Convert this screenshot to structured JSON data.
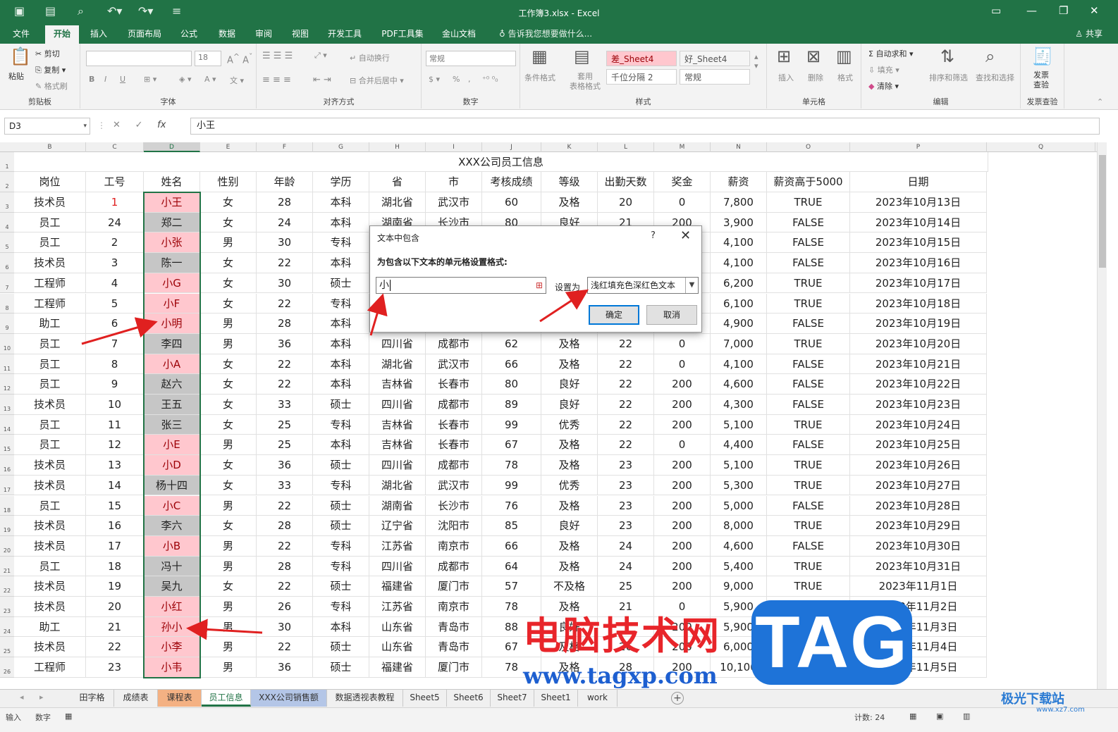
{
  "window": {
    "title": "工作簿3.xlsx - Excel",
    "quick_access": [
      "save-icon",
      "touch-icon",
      "preview-icon",
      "undo-icon",
      "redo-icon",
      "customize-icon"
    ]
  },
  "ribbon_tabs": [
    "文件",
    "开始",
    "插入",
    "页面布局",
    "公式",
    "数据",
    "审阅",
    "视图",
    "开发工具",
    "PDF工具集",
    "金山文档"
  ],
  "active_tab": "开始",
  "tell_me": "告诉我您想要做什么...",
  "share_label": "共享",
  "ribbon": {
    "clipboard": {
      "paste": "粘贴",
      "cut": "剪切",
      "copy": "复制",
      "format_painter": "格式刷",
      "label": "剪贴板"
    },
    "font": {
      "font_size": "18",
      "label": "字体",
      "bold": "B",
      "italic": "I",
      "underline": "U"
    },
    "alignment": {
      "wrap": "自动换行",
      "merge": "合并后居中",
      "label": "对齐方式"
    },
    "number": {
      "format": "常规",
      "percent": "%",
      "label": "数字"
    },
    "styles": {
      "conditional": "条件格式",
      "table": "套用\n表格格式",
      "cells": [
        "差_Sheet4",
        "好_Sheet4",
        "千位分隔 2",
        "常规"
      ],
      "label": "样式"
    },
    "cells": {
      "insert": "插入",
      "delete": "删除",
      "format": "格式",
      "label": "单元格"
    },
    "editing": {
      "autosum": "自动求和",
      "fill": "填充",
      "clear": "清除",
      "sort": "排序和筛选",
      "find": "查找和选择",
      "label": "编辑"
    },
    "invoice": {
      "check": "发票\n查验",
      "label": "发票查验"
    }
  },
  "formula_bar": {
    "name_box": "D3",
    "fx": "fx",
    "value": "小王"
  },
  "columns": [
    "B",
    "C",
    "D",
    "E",
    "F",
    "G",
    "H",
    "I",
    "J",
    "K",
    "L",
    "M",
    "N",
    "O",
    "P",
    "Q"
  ],
  "selected_column": "D",
  "sheet_title": "XXX公司员工信息",
  "headers": [
    "岗位",
    "工号",
    "姓名",
    "性别",
    "年龄",
    "学历",
    "省",
    "市",
    "考核成绩",
    "等级",
    "出勤天数",
    "奖金",
    "薪资",
    "薪资高于5000",
    "日期"
  ],
  "rows": [
    [
      "技术员",
      "1",
      "小王",
      "女",
      "28",
      "本科",
      "湖北省",
      "武汉市",
      "60",
      "及格",
      "20",
      "0",
      "7,800",
      "TRUE",
      "2023年10月13日"
    ],
    [
      "员工",
      "24",
      "郑二",
      "女",
      "24",
      "本科",
      "湖南省",
      "长沙市",
      "80",
      "良好",
      "21",
      "200",
      "3,900",
      "FALSE",
      "2023年10月14日"
    ],
    [
      "员工",
      "2",
      "小张",
      "男",
      "30",
      "专科",
      "",
      "",
      "",
      "",
      "",
      "",
      "4,100",
      "FALSE",
      "2023年10月15日"
    ],
    [
      "技术员",
      "3",
      "陈一",
      "女",
      "22",
      "本科",
      "",
      "",
      "",
      "",
      "",
      "",
      "4,100",
      "FALSE",
      "2023年10月16日"
    ],
    [
      "工程师",
      "4",
      "小G",
      "女",
      "30",
      "硕士",
      "",
      "",
      "",
      "",
      "",
      "",
      "6,200",
      "TRUE",
      "2023年10月17日"
    ],
    [
      "工程师",
      "5",
      "小F",
      "女",
      "22",
      "专科",
      "",
      "",
      "",
      "",
      "",
      "",
      "6,100",
      "TRUE",
      "2023年10月18日"
    ],
    [
      "助工",
      "6",
      "小明",
      "男",
      "28",
      "本科",
      "",
      "",
      "",
      "",
      "",
      "",
      "4,900",
      "FALSE",
      "2023年10月19日"
    ],
    [
      "员工",
      "7",
      "李四",
      "男",
      "36",
      "本科",
      "四川省",
      "成都市",
      "62",
      "及格",
      "22",
      "0",
      "7,000",
      "TRUE",
      "2023年10月20日"
    ],
    [
      "员工",
      "8",
      "小A",
      "女",
      "22",
      "本科",
      "湖北省",
      "武汉市",
      "66",
      "及格",
      "22",
      "0",
      "4,100",
      "FALSE",
      "2023年10月21日"
    ],
    [
      "员工",
      "9",
      "赵六",
      "女",
      "22",
      "本科",
      "吉林省",
      "长春市",
      "80",
      "良好",
      "22",
      "200",
      "4,600",
      "FALSE",
      "2023年10月22日"
    ],
    [
      "技术员",
      "10",
      "王五",
      "女",
      "33",
      "硕士",
      "四川省",
      "成都市",
      "89",
      "良好",
      "22",
      "200",
      "4,300",
      "FALSE",
      "2023年10月23日"
    ],
    [
      "员工",
      "11",
      "张三",
      "女",
      "25",
      "专科",
      "吉林省",
      "长春市",
      "99",
      "优秀",
      "22",
      "200",
      "5,100",
      "TRUE",
      "2023年10月24日"
    ],
    [
      "员工",
      "12",
      "小E",
      "男",
      "25",
      "本科",
      "吉林省",
      "长春市",
      "67",
      "及格",
      "22",
      "0",
      "4,400",
      "FALSE",
      "2023年10月25日"
    ],
    [
      "技术员",
      "13",
      "小D",
      "女",
      "36",
      "硕士",
      "四川省",
      "成都市",
      "78",
      "及格",
      "23",
      "200",
      "5,100",
      "TRUE",
      "2023年10月26日"
    ],
    [
      "技术员",
      "14",
      "杨十四",
      "女",
      "33",
      "专科",
      "湖北省",
      "武汉市",
      "99",
      "优秀",
      "23",
      "200",
      "5,300",
      "TRUE",
      "2023年10月27日"
    ],
    [
      "员工",
      "15",
      "小C",
      "男",
      "22",
      "硕士",
      "湖南省",
      "长沙市",
      "76",
      "及格",
      "23",
      "200",
      "5,000",
      "FALSE",
      "2023年10月28日"
    ],
    [
      "技术员",
      "16",
      "李六",
      "女",
      "28",
      "硕士",
      "辽宁省",
      "沈阳市",
      "85",
      "良好",
      "23",
      "200",
      "8,000",
      "TRUE",
      "2023年10月29日"
    ],
    [
      "技术员",
      "17",
      "小B",
      "男",
      "22",
      "专科",
      "江苏省",
      "南京市",
      "66",
      "及格",
      "24",
      "200",
      "4,600",
      "FALSE",
      "2023年10月30日"
    ],
    [
      "员工",
      "18",
      "冯十",
      "男",
      "28",
      "专科",
      "四川省",
      "成都市",
      "64",
      "及格",
      "24",
      "200",
      "5,400",
      "TRUE",
      "2023年10月31日"
    ],
    [
      "技术员",
      "19",
      "吴九",
      "女",
      "22",
      "硕士",
      "福建省",
      "厦门市",
      "57",
      "不及格",
      "25",
      "200",
      "9,000",
      "TRUE",
      "2023年11月1日"
    ],
    [
      "技术员",
      "20",
      "小红",
      "男",
      "26",
      "专科",
      "江苏省",
      "南京市",
      "78",
      "及格",
      "21",
      "0",
      "5,900",
      "TRUE",
      "2023年11月2日"
    ],
    [
      "助工",
      "21",
      "孙小",
      "男",
      "30",
      "本科",
      "山东省",
      "青岛市",
      "88",
      "良好",
      "",
      "200",
      "5,900",
      "FALSE",
      "2023年11月3日"
    ],
    [
      "技术员",
      "22",
      "小李",
      "男",
      "22",
      "硕士",
      "山东省",
      "青岛市",
      "67",
      "及格",
      "26",
      "200",
      "6,000",
      "TRUE",
      "2023年11月4日"
    ],
    [
      "工程师",
      "23",
      "小韦",
      "男",
      "36",
      "硕士",
      "福建省",
      "厦门市",
      "78",
      "及格",
      "28",
      "200",
      "10,100",
      "TRUE",
      "2023年11月5日"
    ]
  ],
  "highlighted_names": [
    "小王",
    "小张",
    "小G",
    "小F",
    "小明",
    "小A",
    "小E",
    "小D",
    "小C",
    "小B",
    "小红",
    "孙小",
    "小李",
    "小韦"
  ],
  "sheet_tabs": [
    "田字格",
    "成绩表",
    "课程表",
    "员工信息",
    "XXX公司销售额",
    "数据透视表教程",
    "Sheet5",
    "Sheet6",
    "Sheet7",
    "Sheet1",
    "work"
  ],
  "active_sheet": "员工信息",
  "status_bar": {
    "mode": "输入",
    "num": "数字",
    "count": "计数: 24"
  },
  "dialog": {
    "title": "文本中包含",
    "help": "?",
    "close": "✕",
    "prompt": "为包含以下文本的单元格设置格式:",
    "input_value": "小",
    "set_as_label": "设置为",
    "format_option": "浅红填充色深红色文本",
    "ok": "确定",
    "cancel": "取消"
  },
  "watermark": {
    "text": "电脑技术网",
    "url": "www.tagxp.com",
    "tag": "TAG",
    "site": "极光下载站",
    "site_url": "www.xz7.com"
  },
  "colors": {
    "excel_green": "#217346",
    "highlight_fill": "#ffc7ce",
    "highlight_text": "#9c0006",
    "arrow_red": "#e02020"
  }
}
